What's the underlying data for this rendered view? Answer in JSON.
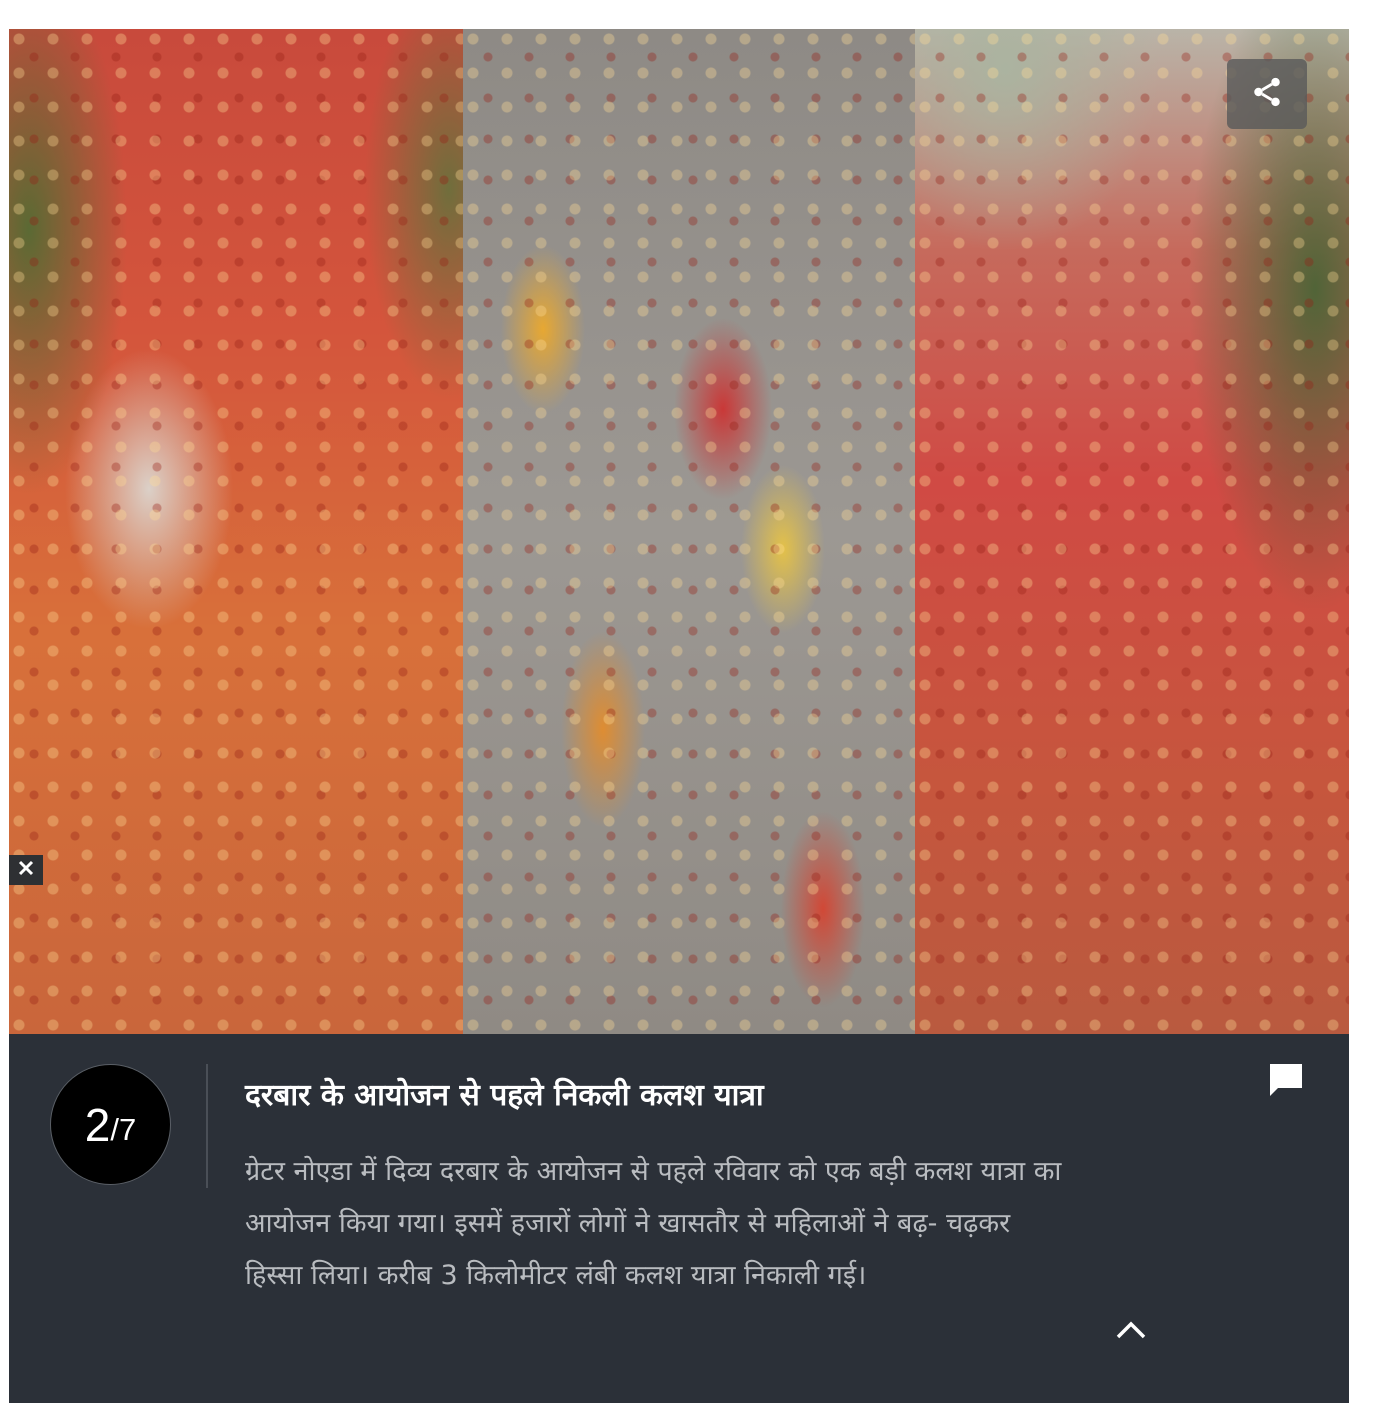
{
  "gallery": {
    "counter": {
      "current": "2",
      "total": "/7"
    },
    "title": "दरबार के आयोजन से पहले निकली कलश यात्रा",
    "description": "ग्रेटर नोएडा में दिव्य दरबार के आयोजन से पहले रविवार को एक बड़ी कलश यात्रा का आयोजन किया गया। इसमें हजारों लोगों ने खासतौर से महिलाओं ने बढ़- चढ़कर हिस्सा लिया। करीब 3 किलोमीटर लंबी कलश यात्रा निकाली गई।",
    "icons": {
      "share": "share-icon",
      "close": "close-icon",
      "comment": "comment-icon",
      "collapse": "chevron-up-icon"
    },
    "colors": {
      "caption_background": "#2b3038",
      "title": "#ffffff",
      "description": "#b9bcc0",
      "counter_background": "#000000"
    }
  }
}
